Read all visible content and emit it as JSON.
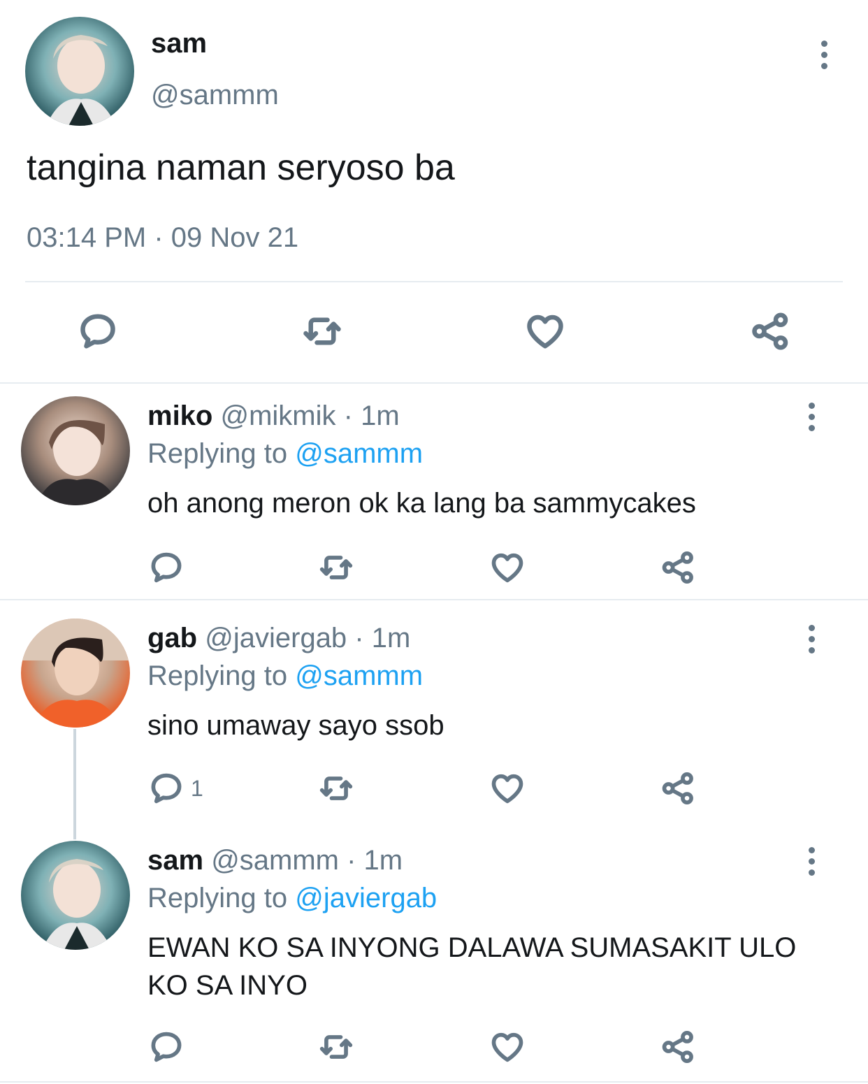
{
  "main_tweet": {
    "display_name": "sam",
    "handle": "@sammm",
    "text": "tangina naman seryoso ba",
    "timestamp": "03:14 PM · 09 Nov 21",
    "actions": [
      "reply-icon",
      "retweet-icon",
      "like-icon",
      "share-icon"
    ]
  },
  "replies": [
    {
      "display_name": "miko",
      "handle": "@mikmik",
      "time": "· 1m",
      "replying_prefix": "Replying to",
      "replying_to": "@sammm",
      "text": "oh anong meron ok ka lang ba sammycakes",
      "reply_count": ""
    },
    {
      "display_name": "gab",
      "handle": "@javiergab",
      "time": "· 1m",
      "replying_prefix": "Replying to",
      "replying_to": "@sammm",
      "text": "sino umaway sayo ssob",
      "reply_count": "1"
    },
    {
      "display_name": "sam",
      "handle": "@sammm",
      "time": "· 1m",
      "replying_prefix": "Replying to",
      "replying_to": "@javiergab",
      "text": "EWAN KO SA INYONG DALAWA SUMASAKIT ULO KO SA INYO",
      "reply_count": ""
    }
  ],
  "colors": {
    "text": "#14171a",
    "secondary": "#657786",
    "link": "#1da1f2",
    "divider": "#e6ecf0"
  }
}
